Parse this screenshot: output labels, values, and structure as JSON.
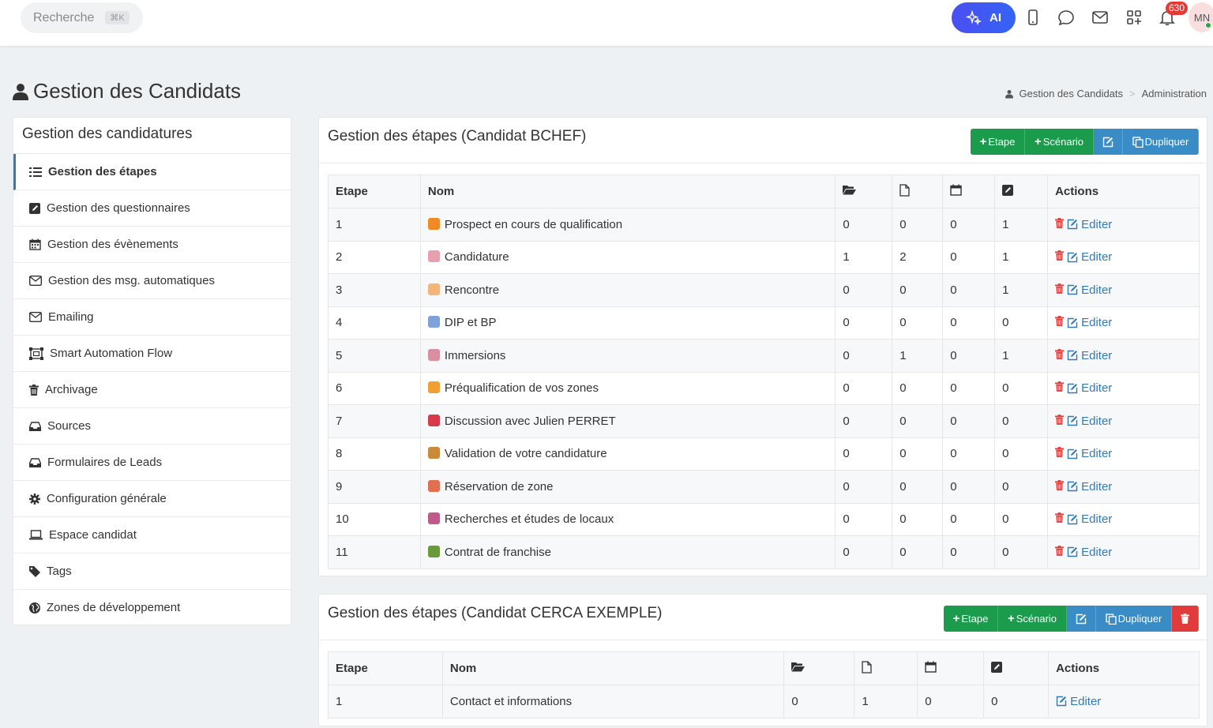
{
  "topbar": {
    "search_label": "Recherche",
    "search_shortcut": "⌘K",
    "ai_label": "AI",
    "notifications_count": "630",
    "avatar_initials": "MN"
  },
  "page": {
    "title": "Gestion des Candidats",
    "breadcrumb": [
      "Gestion des Candidats",
      "Administration"
    ]
  },
  "sidebar": {
    "title": "Gestion des candidatures",
    "items": [
      {
        "label": "Gestion des étapes",
        "icon": "list-icon"
      },
      {
        "label": "Gestion des questionnaires",
        "icon": "edit-icon"
      },
      {
        "label": "Gestion des évènements",
        "icon": "calendar-icon"
      },
      {
        "label": "Gestion des msg. automatiques",
        "icon": "envelope-icon"
      },
      {
        "label": "Emailing",
        "icon": "envelope-icon"
      },
      {
        "label": "Smart Automation Flow",
        "icon": "flow-icon"
      },
      {
        "label": "Archivage",
        "icon": "trash-icon"
      },
      {
        "label": "Sources",
        "icon": "inbox-icon"
      },
      {
        "label": "Formulaires de Leads",
        "icon": "inbox-icon"
      },
      {
        "label": "Configuration générale",
        "icon": "gear-icon"
      },
      {
        "label": "Espace candidat",
        "icon": "laptop-icon"
      },
      {
        "label": "Tags",
        "icon": "tag-icon"
      },
      {
        "label": "Zones de développement",
        "icon": "globe-icon"
      }
    ]
  },
  "panels": [
    {
      "title": "Gestion des étapes (Candidat BCHEF)",
      "buttons": {
        "etape": "Etape",
        "scenario": "Scénario",
        "dupliquer": "Dupliquer"
      },
      "headers": {
        "etape": "Etape",
        "nom": "Nom",
        "actions": "Actions"
      },
      "edit_label": "Editer",
      "rows": [
        {
          "etape": "1",
          "emoji_color": "#f08a24",
          "nom": "Prospect en cours de qualification",
          "c1": "0",
          "c2": "0",
          "c3": "0",
          "c4": "1"
        },
        {
          "etape": "2",
          "emoji_color": "#e8a0b0",
          "nom": "Candidature",
          "c1": "1",
          "c2": "2",
          "c3": "0",
          "c4": "1"
        },
        {
          "etape": "3",
          "emoji_color": "#f5b57a",
          "nom": "Rencontre",
          "c1": "0",
          "c2": "0",
          "c3": "0",
          "c4": "1"
        },
        {
          "etape": "4",
          "emoji_color": "#7fa3d8",
          "nom": "DIP et BP",
          "c1": "0",
          "c2": "0",
          "c3": "0",
          "c4": "0"
        },
        {
          "etape": "5",
          "emoji_color": "#d98fa0",
          "nom": "Immersions",
          "c1": "0",
          "c2": "1",
          "c3": "0",
          "c4": "1"
        },
        {
          "etape": "6",
          "emoji_color": "#f0a030",
          "nom": "Préqualification de vos zones",
          "c1": "0",
          "c2": "0",
          "c3": "0",
          "c4": "0"
        },
        {
          "etape": "7",
          "emoji_color": "#d83a4a",
          "nom": "Discussion avec Julien PERRET",
          "c1": "0",
          "c2": "0",
          "c3": "0",
          "c4": "0"
        },
        {
          "etape": "8",
          "emoji_color": "#c98a3a",
          "nom": "Validation de votre candidature",
          "c1": "0",
          "c2": "0",
          "c3": "0",
          "c4": "0"
        },
        {
          "etape": "9",
          "emoji_color": "#e07050",
          "nom": "Réservation de zone",
          "c1": "0",
          "c2": "0",
          "c3": "0",
          "c4": "0"
        },
        {
          "etape": "10",
          "emoji_color": "#c05a8a",
          "nom": "Recherches et études de locaux",
          "c1": "0",
          "c2": "0",
          "c3": "0",
          "c4": "0"
        },
        {
          "etape": "11",
          "emoji_color": "#6a9a3a",
          "nom": "Contrat de franchise",
          "c1": "0",
          "c2": "0",
          "c3": "0",
          "c4": "0"
        }
      ]
    },
    {
      "title": "Gestion des étapes (Candidat CERCA EXEMPLE)",
      "buttons": {
        "etape": "Etape",
        "scenario": "Scénario",
        "dupliquer": "Dupliquer"
      },
      "headers": {
        "etape": "Etape",
        "nom": "Nom",
        "actions": "Actions"
      },
      "edit_label": "Editer",
      "rows": [
        {
          "etape": "1",
          "nom": "Contact et informations",
          "c1": "0",
          "c2": "1",
          "c3": "0",
          "c4": "0"
        }
      ]
    }
  ],
  "colors": {
    "primary": "#337ab7",
    "success": "#1a9c4c",
    "info": "#3a8cc7",
    "danger": "#e03c3c",
    "ai_gradient_start": "#4b4ef0"
  }
}
